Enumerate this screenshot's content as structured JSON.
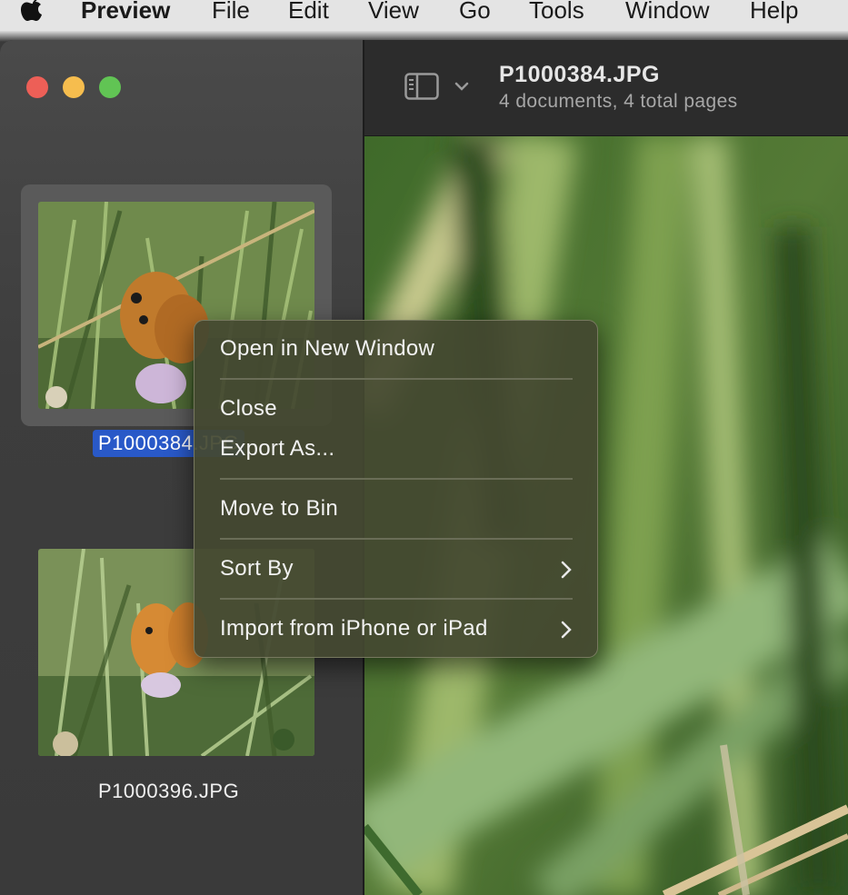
{
  "menubar": {
    "app": "Preview",
    "items": [
      "File",
      "Edit",
      "View",
      "Go",
      "Tools",
      "Window",
      "Help"
    ]
  },
  "sidebar": {
    "thumbnails": [
      {
        "label": "P1000384.JPG",
        "selected": true
      },
      {
        "label": "P1000396.JPG",
        "selected": false
      }
    ]
  },
  "toolbar": {
    "title": "P1000384.JPG",
    "subtitle": "4 documents, 4 total pages",
    "sidebar_toggle_icon": "sidebar-icon"
  },
  "context_menu": {
    "items": [
      {
        "label": "Open in New Window"
      },
      {
        "label": "Close"
      },
      {
        "label": "Export As..."
      },
      {
        "label": "Move to Bin"
      },
      {
        "label": "Sort By",
        "submenu": true
      },
      {
        "label": "Import from iPhone or iPad",
        "submenu": true
      }
    ]
  },
  "colors": {
    "selection": "#2959c8",
    "close": "#ed5f57",
    "minimize": "#f6bd4e",
    "zoom": "#61c454"
  }
}
